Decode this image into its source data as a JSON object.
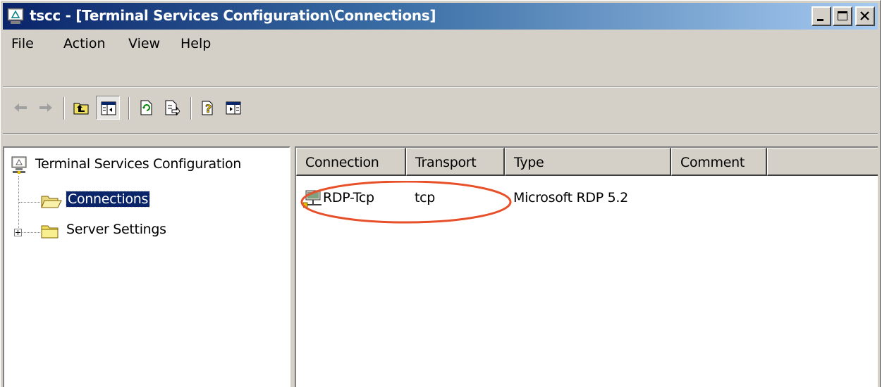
{
  "window": {
    "title": "tscc - [Terminal Services Configuration\\Connections]",
    "title_bar_color": "#0a246a"
  },
  "menubar": {
    "items": [
      {
        "label": "File"
      },
      {
        "label": "Action"
      },
      {
        "label": "View"
      },
      {
        "label": "Help"
      }
    ]
  },
  "toolbar": {
    "buttons": [
      {
        "icon": "back-arrow-icon"
      },
      {
        "icon": "forward-arrow-icon"
      },
      {
        "icon": "up-one-level-icon"
      },
      {
        "icon": "show-hide-console-tree-icon",
        "pressed": true
      },
      {
        "icon": "refresh-icon"
      },
      {
        "icon": "export-list-icon"
      },
      {
        "icon": "help-icon"
      },
      {
        "icon": "show-hide-action-pane-icon"
      }
    ]
  },
  "tree": {
    "root": "Terminal Services Configuration",
    "items": [
      {
        "label": "Connections",
        "selected": true
      },
      {
        "label": "Server Settings",
        "selected": false
      }
    ]
  },
  "list": {
    "columns": [
      "Connection",
      "Transport",
      "Type",
      "Comment"
    ],
    "rows": [
      {
        "connection": "RDP-Tcp",
        "transport": "tcp",
        "type": "Microsoft RDP 5.2",
        "comment": ""
      }
    ]
  },
  "annotation": {
    "highlight_color": "#e8502a"
  }
}
